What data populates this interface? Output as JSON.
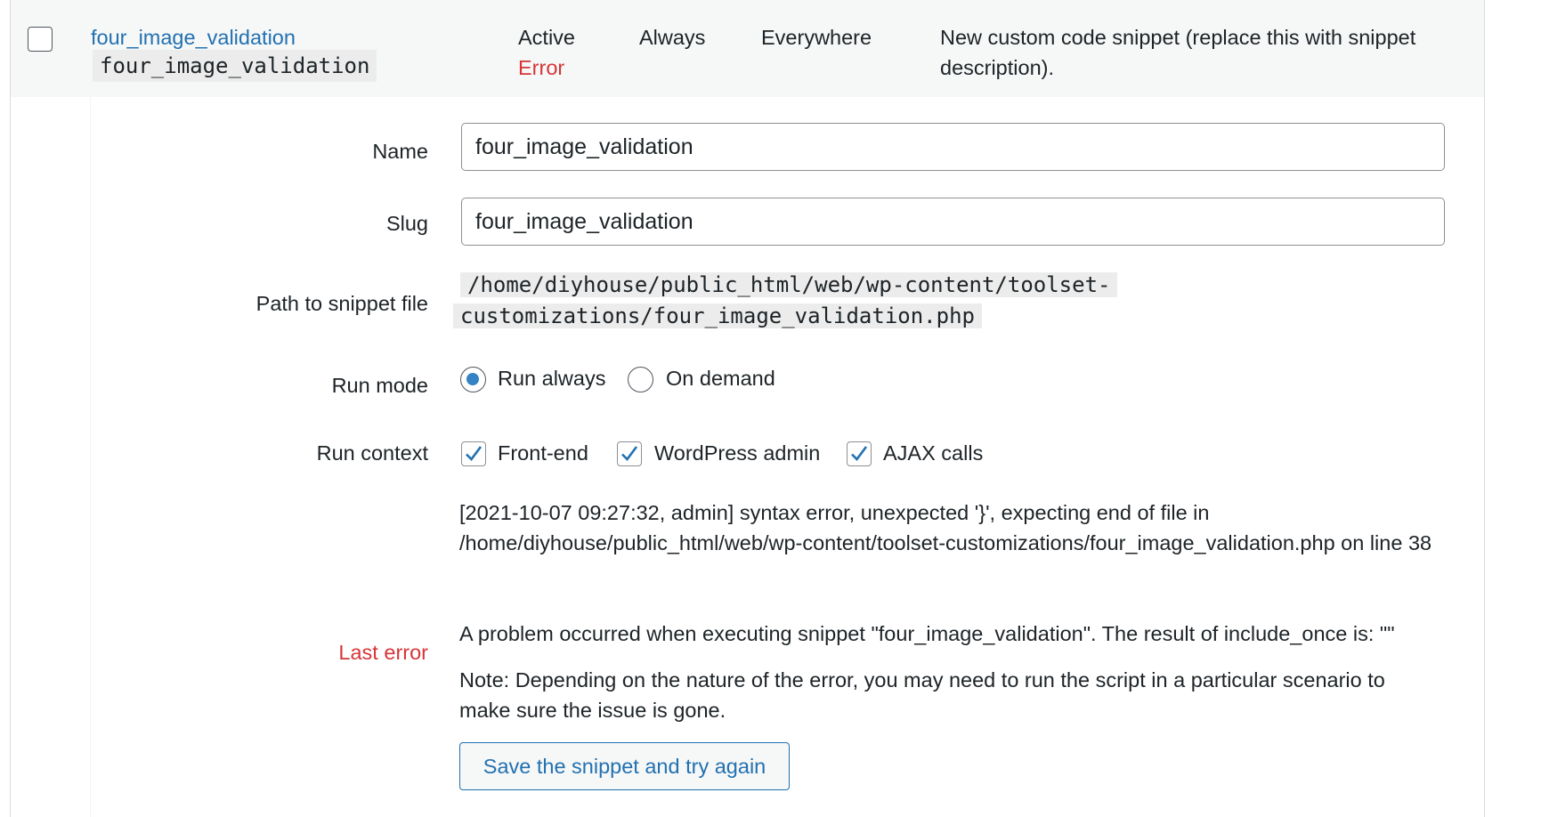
{
  "row": {
    "title_link": "four_image_validation",
    "slug_code": "four_image_validation",
    "status": "Active",
    "status_error": "Error",
    "run_mode": "Always",
    "run_context": "Everywhere",
    "description": "New custom code snippet (replace this with snippet description)."
  },
  "form": {
    "name_label": "Name",
    "name_value": "four_image_validation",
    "slug_label": "Slug",
    "slug_value": "four_image_validation",
    "path_label": "Path to snippet file",
    "path_line1": "/home/diyhouse/public_html/web/wp-content/toolset-",
    "path_line2": "customizations/four_image_validation.php",
    "run_mode_label": "Run mode",
    "run_mode_options": [
      {
        "label": "Run always",
        "selected": true
      },
      {
        "label": "On demand",
        "selected": false
      }
    ],
    "run_context_label": "Run context",
    "run_context_options": [
      {
        "label": "Front-end",
        "checked": true
      },
      {
        "label": "WordPress admin",
        "checked": true
      },
      {
        "label": "AJAX calls",
        "checked": true
      }
    ],
    "last_error_label": "Last error",
    "error_log": "[2021-10-07 09:27:32, admin] syntax error, unexpected '}', expecting end of file in /home/diyhouse/public_html/web/wp-content/toolset-customizations/four_image_validation.php on line 38",
    "error_problem": "A problem occurred when executing snippet \"four_image_validation\". The result of include_once is: \"\"",
    "error_note": "Note: Depending on the nature of the error, you may need to run the script in a particular scenario to make sure the issue is gone.",
    "save_button": "Save the snippet and try again"
  },
  "colors": {
    "link": "#2271b1",
    "error": "#d63638",
    "row_bg": "#f6f7f7",
    "radio_accent": "#3582c4"
  }
}
